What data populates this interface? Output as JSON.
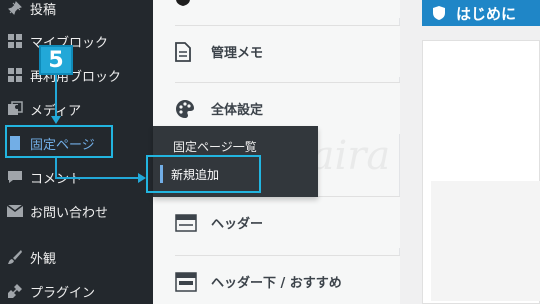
{
  "sidebar": {
    "items": [
      {
        "label": "投稿",
        "icon": "pin-icon"
      },
      {
        "label": "マイブロック",
        "icon": "grid-icon"
      },
      {
        "label": "再利用ブロック",
        "icon": "grid-icon"
      },
      {
        "label": "メディア",
        "icon": "media-icon"
      },
      {
        "label": "固定ページ",
        "icon": "page-icon"
      },
      {
        "label": "コメント",
        "icon": "comment-icon"
      },
      {
        "label": "お問い合わせ",
        "icon": "mail-icon"
      },
      {
        "label": "外観",
        "icon": "brush-icon"
      },
      {
        "label": "プラグイン",
        "icon": "plugin-icon"
      }
    ]
  },
  "flyout": {
    "title": "固定ページ一覧",
    "new_label": "新規追加"
  },
  "panel": {
    "items": [
      {
        "label": "管理メモ",
        "icon": "document-icon"
      },
      {
        "label": "全体設定",
        "icon": "palette-icon"
      },
      {
        "label": "ヘッダー",
        "icon": "header-layout-icon"
      },
      {
        "label": "ヘッダー下 / おすすめ",
        "icon": "header-below-layout-icon"
      }
    ]
  },
  "content": {
    "banner_title": "はじめに"
  },
  "annotation": {
    "step_number": "5",
    "watermark": "kudaira"
  },
  "colors": {
    "sidebar_bg": "#23282d",
    "highlight": "#22b5e0",
    "banner": "#1f86c7"
  }
}
